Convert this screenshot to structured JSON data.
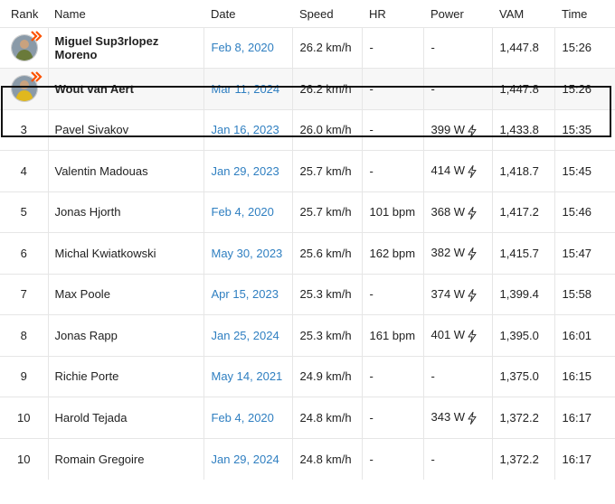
{
  "headers": {
    "rank": "Rank",
    "name": "Name",
    "date": "Date",
    "speed": "Speed",
    "hr": "HR",
    "power": "Power",
    "vam": "VAM",
    "time": "Time"
  },
  "rows": [
    {
      "rank": "",
      "name": "Miguel Sup3rlopez Moreno",
      "date": "Feb 8, 2020",
      "speed": "26.2 km/h",
      "hr": "-",
      "power": "-",
      "vam": "1,447.8",
      "time": "15:26",
      "avatar": true,
      "bold": true,
      "power_meter": false
    },
    {
      "rank": "",
      "name": "Wout van Aert",
      "date": "Mar 11, 2024",
      "speed": "26.2 km/h",
      "hr": "-",
      "power": "-",
      "vam": "1,447.8",
      "time": "15:26",
      "avatar": true,
      "bold": true,
      "power_meter": false
    },
    {
      "rank": "3",
      "name": "Pavel Sivakov",
      "date": "Jan 16, 2023",
      "speed": "26.0 km/h",
      "hr": "-",
      "power": "399 W",
      "vam": "1,433.8",
      "time": "15:35",
      "power_meter": true
    },
    {
      "rank": "4",
      "name": "Valentin Madouas",
      "date": "Jan 29, 2023",
      "speed": "25.7 km/h",
      "hr": "-",
      "power": "414 W",
      "vam": "1,418.7",
      "time": "15:45",
      "power_meter": true
    },
    {
      "rank": "5",
      "name": "Jonas Hjorth",
      "date": "Feb 4, 2020",
      "speed": "25.7 km/h",
      "hr": "101 bpm",
      "power": "368 W",
      "vam": "1,417.2",
      "time": "15:46",
      "power_meter": true
    },
    {
      "rank": "6",
      "name": "Michal Kwiatkowski",
      "date": "May 30, 2023",
      "speed": "25.6 km/h",
      "hr": "162 bpm",
      "power": "382 W",
      "vam": "1,415.7",
      "time": "15:47",
      "power_meter": true
    },
    {
      "rank": "7",
      "name": "Max Poole",
      "date": "Apr 15, 2023",
      "speed": "25.3 km/h",
      "hr": "-",
      "power": "374 W",
      "vam": "1,399.4",
      "time": "15:58",
      "power_meter": true
    },
    {
      "rank": "8",
      "name": "Jonas Rapp",
      "date": "Jan 25, 2024",
      "speed": "25.3 km/h",
      "hr": "161 bpm",
      "power": "401 W",
      "vam": "1,395.0",
      "time": "16:01",
      "power_meter": true
    },
    {
      "rank": "9",
      "name": "Richie Porte",
      "date": "May 14, 2021",
      "speed": "24.9 km/h",
      "hr": "-",
      "power": "-",
      "vam": "1,375.0",
      "time": "16:15",
      "power_meter": false
    },
    {
      "rank": "10",
      "name": "Harold Tejada",
      "date": "Feb 4, 2020",
      "speed": "24.8 km/h",
      "hr": "-",
      "power": "343 W",
      "vam": "1,372.2",
      "time": "16:17",
      "power_meter": true
    },
    {
      "rank": "10",
      "name": "Romain Gregoire",
      "date": "Jan 29, 2024",
      "speed": "24.8 km/h",
      "hr": "-",
      "power": "-",
      "vam": "1,372.2",
      "time": "16:17",
      "power_meter": false
    }
  ],
  "highlight_row": 1,
  "colors": {
    "link": "#2f7fc1",
    "badge": "#fc5200",
    "border": "#e6e6e6"
  }
}
